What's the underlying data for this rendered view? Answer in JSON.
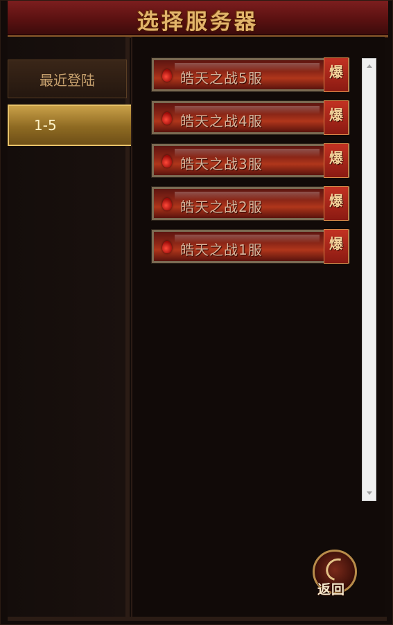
{
  "window": {
    "title": "选择服务器"
  },
  "sidebar": {
    "items": [
      {
        "label": "最近登陆",
        "active": false
      },
      {
        "label": "1-5",
        "active": true
      }
    ]
  },
  "servers": [
    {
      "name": "皓天之战5服",
      "badge": "爆"
    },
    {
      "name": "皓天之战4服",
      "badge": "爆"
    },
    {
      "name": "皓天之战3服",
      "badge": "爆"
    },
    {
      "name": "皓天之战2服",
      "badge": "爆"
    },
    {
      "name": "皓天之战1服",
      "badge": "爆"
    }
  ],
  "back_button": {
    "label": "返回"
  },
  "colors": {
    "title_gold": "#e2b46a",
    "title_bar_red": "#7c1e1e",
    "active_tab_gold": "#c9a048",
    "server_red": "#b0361b",
    "badge_red": "#c23222"
  }
}
